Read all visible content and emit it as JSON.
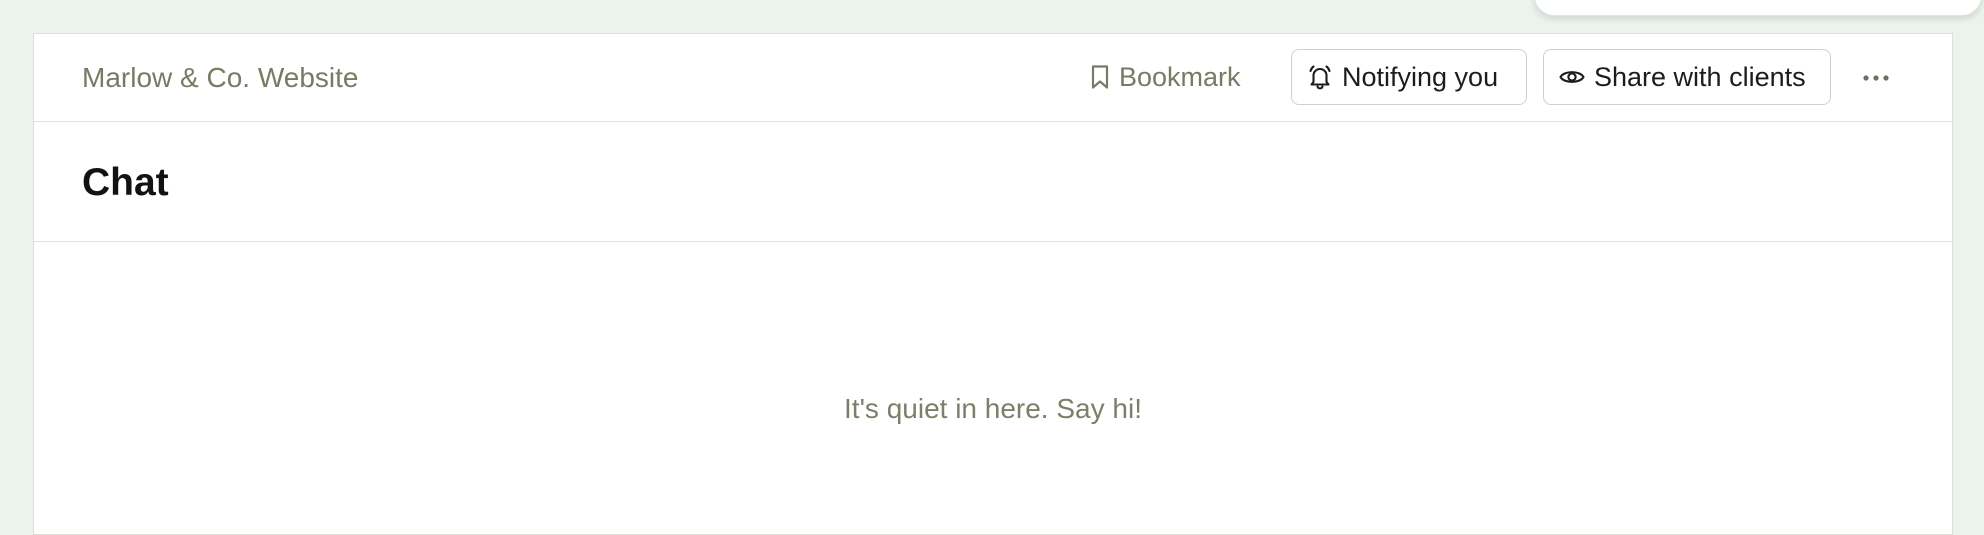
{
  "project": {
    "name": "Marlow & Co. Website"
  },
  "toolbar": {
    "bookmark_label": "Bookmark",
    "notify_label": "Notifying you",
    "share_label": "Share with clients"
  },
  "icons": {
    "bookmark": "bookmark-icon",
    "notify": "bell-ringing-icon",
    "share": "eye-icon",
    "more": "more-horizontal-icon"
  },
  "page": {
    "title": "Chat",
    "empty_message": "It's quiet in here. Say hi!"
  },
  "colors": {
    "background": "#ecf3ec",
    "muted_text": "#787b64",
    "title_text": "#121210",
    "button_border": "#cfd0cb"
  }
}
